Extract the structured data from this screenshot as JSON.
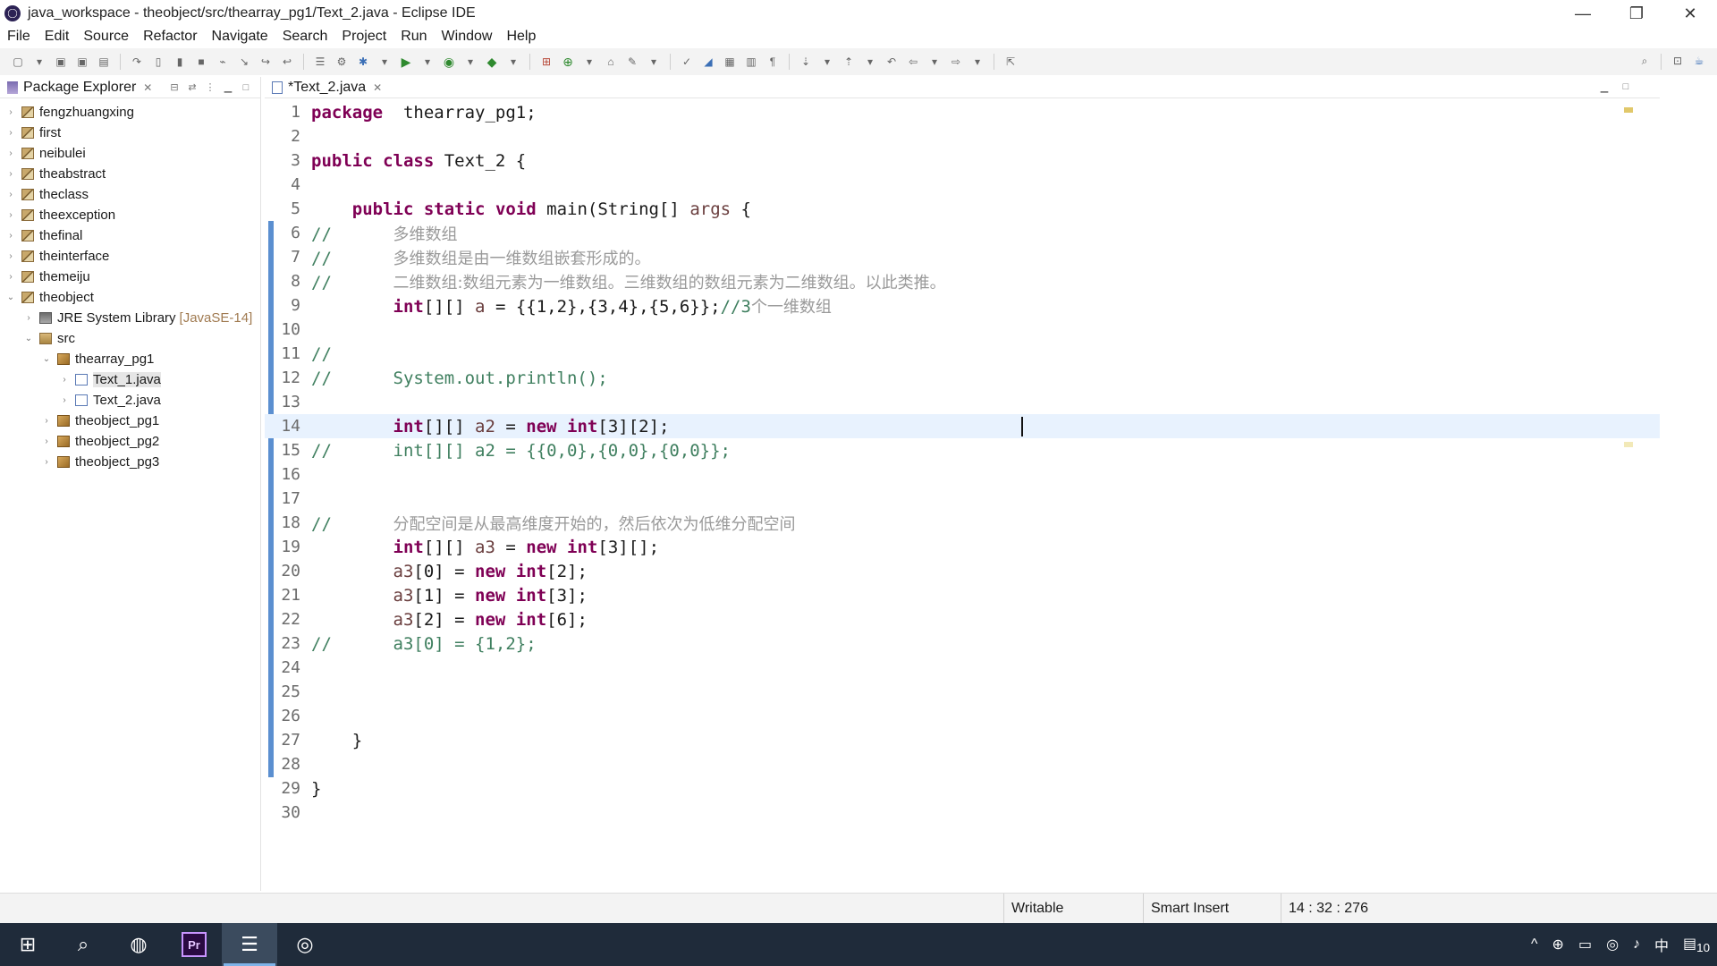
{
  "window": {
    "title": "java_workspace - theobject/src/thearray_pg1/Text_2.java - Eclipse IDE",
    "controls": [
      "—",
      "❐",
      "✕"
    ]
  },
  "menu": [
    "File",
    "Edit",
    "Source",
    "Refactor",
    "Navigate",
    "Search",
    "Project",
    "Run",
    "Window",
    "Help"
  ],
  "package_explorer": {
    "title": "Package Explorer",
    "close": "✕",
    "projects": [
      {
        "label": "fengzhuangxing"
      },
      {
        "label": "first"
      },
      {
        "label": "neibulei"
      },
      {
        "label": "theabstract"
      },
      {
        "label": "theclass"
      },
      {
        "label": "theexception"
      },
      {
        "label": "thefinal"
      },
      {
        "label": "theinterface"
      },
      {
        "label": "themeiju"
      },
      {
        "label": "theobject"
      }
    ],
    "jre_label": "JRE System Library",
    "jre_suffix": "[JavaSE-14]",
    "src_label": "src",
    "packages": [
      {
        "label": "thearray_pg1"
      },
      {
        "label": "theobject_pg1"
      },
      {
        "label": "theobject_pg2"
      },
      {
        "label": "theobject_pg3"
      }
    ],
    "files": [
      {
        "label": "Text_1.java"
      },
      {
        "label": "Text_2.java"
      }
    ]
  },
  "editor": {
    "tab_label": "*Text_2.java",
    "tab_close": "✕",
    "cursor": {
      "line": 14,
      "column": 32,
      "offset": 276
    }
  },
  "code_lines": [
    {
      "n": "1",
      "segs": [
        [
          "kw",
          "package"
        ],
        [
          "",
          "  thearray_pg1;"
        ]
      ]
    },
    {
      "n": "2",
      "segs": []
    },
    {
      "n": "3",
      "segs": [
        [
          "kw",
          "public"
        ],
        [
          "",
          " "
        ],
        [
          "kw",
          "class"
        ],
        [
          "",
          " Text_2 {"
        ]
      ]
    },
    {
      "n": "4",
      "segs": []
    },
    {
      "n": "5",
      "segs": [
        [
          "",
          "    "
        ],
        [
          "kw",
          "public"
        ],
        [
          "",
          " "
        ],
        [
          "kw",
          "static"
        ],
        [
          "",
          " "
        ],
        [
          "kw",
          "void"
        ],
        [
          "",
          " main(String[] "
        ],
        [
          "var",
          "args"
        ],
        [
          "",
          " {"
        ]
      ]
    },
    {
      "n": "6",
      "segs": [
        [
          "cm",
          "//      "
        ],
        [
          "cjk",
          "多维数组"
        ]
      ]
    },
    {
      "n": "7",
      "segs": [
        [
          "cm",
          "//      "
        ],
        [
          "cjk",
          "多维数组是由一维数组嵌套形成的。"
        ]
      ]
    },
    {
      "n": "8",
      "segs": [
        [
          "cm",
          "//      "
        ],
        [
          "cjk",
          "二维数组:数组元素为一维数组。三维数组的数组元素为二维数组。以此类推。"
        ]
      ]
    },
    {
      "n": "9",
      "segs": [
        [
          "",
          "        "
        ],
        [
          "kw",
          "int"
        ],
        [
          "",
          "[][] "
        ],
        [
          "var",
          "a"
        ],
        [
          "",
          " = {{1,2},{3,4},{5,6}};"
        ],
        [
          "cm",
          "//3"
        ],
        [
          "cjk",
          "个一维数组"
        ]
      ]
    },
    {
      "n": "10",
      "segs": []
    },
    {
      "n": "11",
      "segs": [
        [
          "cm",
          "//"
        ]
      ]
    },
    {
      "n": "12",
      "segs": [
        [
          "cm",
          "//      System.out.println();"
        ]
      ]
    },
    {
      "n": "13",
      "segs": []
    },
    {
      "n": "14",
      "segs": [
        [
          "",
          "        "
        ],
        [
          "kw",
          "int"
        ],
        [
          "",
          "[][] "
        ],
        [
          "var",
          "a2"
        ],
        [
          "",
          " = "
        ],
        [
          "kw",
          "new"
        ],
        [
          "",
          " "
        ],
        [
          "kw",
          "int"
        ],
        [
          "",
          "[3][2];"
        ]
      ]
    },
    {
      "n": "15",
      "segs": [
        [
          "cm",
          "//      int[][] a2 = {{0,0},{0,0},{0,0}};"
        ]
      ]
    },
    {
      "n": "16",
      "segs": []
    },
    {
      "n": "17",
      "segs": []
    },
    {
      "n": "18",
      "segs": [
        [
          "cm",
          "//      "
        ],
        [
          "cjk",
          "分配空间是从最高维度开始的，然后依次为低维分配空间"
        ]
      ]
    },
    {
      "n": "19",
      "segs": [
        [
          "",
          "        "
        ],
        [
          "kw",
          "int"
        ],
        [
          "",
          "[][] "
        ],
        [
          "var",
          "a3"
        ],
        [
          "",
          " = "
        ],
        [
          "kw",
          "new"
        ],
        [
          "",
          " "
        ],
        [
          "kw",
          "int"
        ],
        [
          "",
          "[3][];"
        ]
      ]
    },
    {
      "n": "20",
      "segs": [
        [
          "",
          "        "
        ],
        [
          "var",
          "a3"
        ],
        [
          "",
          "[0] = "
        ],
        [
          "kw",
          "new"
        ],
        [
          "",
          " "
        ],
        [
          "kw",
          "int"
        ],
        [
          "",
          "[2];"
        ]
      ]
    },
    {
      "n": "21",
      "segs": [
        [
          "",
          "        "
        ],
        [
          "var",
          "a3"
        ],
        [
          "",
          "[1] = "
        ],
        [
          "kw",
          "new"
        ],
        [
          "",
          " "
        ],
        [
          "kw",
          "int"
        ],
        [
          "",
          "[3];"
        ]
      ]
    },
    {
      "n": "22",
      "segs": [
        [
          "",
          "        "
        ],
        [
          "var",
          "a3"
        ],
        [
          "",
          "[2] = "
        ],
        [
          "kw",
          "new"
        ],
        [
          "",
          " "
        ],
        [
          "kw",
          "int"
        ],
        [
          "",
          "[6];"
        ]
      ]
    },
    {
      "n": "23",
      "segs": [
        [
          "cm",
          "//      a3[0] = {1,2};"
        ]
      ]
    },
    {
      "n": "24",
      "segs": []
    },
    {
      "n": "25",
      "segs": []
    },
    {
      "n": "26",
      "segs": []
    },
    {
      "n": "27",
      "segs": [
        [
          "",
          "    }"
        ]
      ]
    },
    {
      "n": "28",
      "segs": []
    },
    {
      "n": "29",
      "segs": [
        [
          "",
          "}"
        ]
      ]
    },
    {
      "n": "30",
      "segs": []
    }
  ],
  "status": {
    "writable": "Writable",
    "insert_mode": "Smart Insert",
    "position": "14 : 32 : 276"
  },
  "taskbar": {
    "premiere_label": "Pr",
    "tray": [
      "^",
      "⊕",
      "▭",
      "◎",
      "♪",
      "中"
    ],
    "notification_count": "10"
  },
  "colors": {
    "keyword": "#7f0055",
    "comment": "#3f7f5f",
    "variable": "#6a3e3e",
    "current_line": "#e8f2fe",
    "taskbar": "#1f2b3a"
  }
}
